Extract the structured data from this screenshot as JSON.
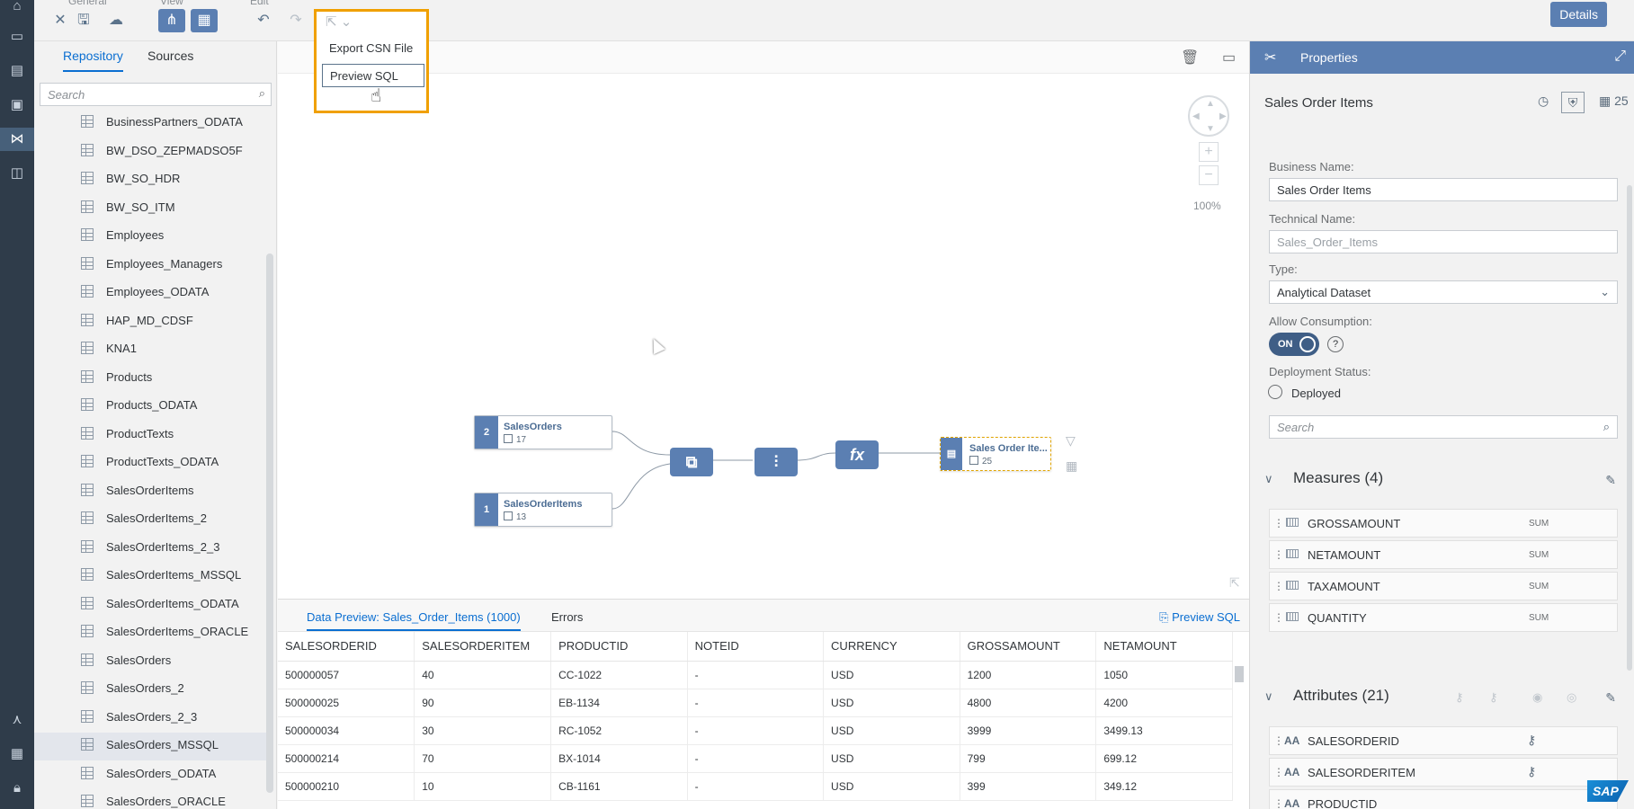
{
  "toolbar": {
    "groups": [
      "General",
      "View",
      "Edit"
    ],
    "details_label": "Details"
  },
  "export_menu": {
    "items": [
      "Export CSN File",
      "Preview SQL"
    ]
  },
  "left_panel": {
    "tabs": [
      "Repository",
      "Sources"
    ],
    "active_tab": "Repository",
    "search_placeholder": "Search",
    "items": [
      "BusinessPartners_ODATA",
      "BW_DSO_ZEPMADSO5F",
      "BW_SO_HDR",
      "BW_SO_ITM",
      "Employees",
      "Employees_Managers",
      "Employees_ODATA",
      "HAP_MD_CDSF",
      "KNA1",
      "Products",
      "Products_ODATA",
      "ProductTexts",
      "ProductTexts_ODATA",
      "SalesOrderItems",
      "SalesOrderItems_2",
      "SalesOrderItems_2_3",
      "SalesOrderItems_MSSQL",
      "SalesOrderItems_ODATA",
      "SalesOrderItems_ORACLE",
      "SalesOrders",
      "SalesOrders_2",
      "SalesOrders_2_3",
      "SalesOrders_MSSQL",
      "SalesOrders_ODATA",
      "SalesOrders_ORACLE"
    ],
    "selected_item": "SalesOrders_MSSQL"
  },
  "canvas": {
    "zoom": "100%",
    "nodes": {
      "sales_orders": {
        "badge": "2",
        "title": "SalesOrders",
        "count": "17"
      },
      "sales_order_items": {
        "badge": "1",
        "title": "SalesOrderItems",
        "count": "13"
      },
      "target": {
        "title": "Sales Order Ite...",
        "count": "25"
      }
    },
    "operators": {
      "join": "⧉",
      "projection": "⫶",
      "calculated": "fx"
    }
  },
  "preview": {
    "tabs": [
      "Data Preview: Sales_Order_Items (1000)",
      "Errors"
    ],
    "preview_sql_label": "Preview SQL",
    "columns": [
      "SALESORDERID",
      "SALESORDERITEM",
      "PRODUCTID",
      "NOTEID",
      "CURRENCY",
      "GROSSAMOUNT",
      "NETAMOUNT"
    ],
    "rows": [
      [
        "500000057",
        "40",
        "CC-1022",
        "-",
        "USD",
        "1200",
        "1050"
      ],
      [
        "500000025",
        "90",
        "EB-1134",
        "-",
        "USD",
        "4800",
        "4200"
      ],
      [
        "500000034",
        "30",
        "RC-1052",
        "-",
        "USD",
        "3999",
        "3499.13"
      ],
      [
        "500000214",
        "70",
        "BX-1014",
        "-",
        "USD",
        "799",
        "699.12"
      ],
      [
        "500000210",
        "10",
        "CB-1161",
        "-",
        "USD",
        "399",
        "349.12"
      ]
    ]
  },
  "properties": {
    "header": "Properties",
    "object_title": "Sales Order Items",
    "object_count": "25",
    "business_name_label": "Business Name:",
    "business_name": "Sales Order Items",
    "technical_name_label": "Technical Name:",
    "technical_name": "Sales_Order_Items",
    "type_label": "Type:",
    "type_value": "Analytical Dataset",
    "allow_consumption_label": "Allow Consumption:",
    "toggle_label": "ON",
    "help_glyph": "?",
    "deployment_status_label": "Deployment Status:",
    "deployment_status": "Deployed",
    "search_placeholder": "Search",
    "measures_header": "Measures (4)",
    "measures": [
      {
        "name": "GROSSAMOUNT",
        "agg": "SUM"
      },
      {
        "name": "NETAMOUNT",
        "agg": "SUM"
      },
      {
        "name": "TAXAMOUNT",
        "agg": "SUM"
      },
      {
        "name": "QUANTITY",
        "agg": "SUM"
      }
    ],
    "attributes_header": "Attributes (21)",
    "attributes": [
      "SALESORDERID",
      "SALESORDERITEM",
      "PRODUCTID"
    ],
    "logo": "SAP"
  },
  "colors": {
    "accent": "#5b7fb2",
    "rail": "#2f3c4a",
    "highlight": "#f0a000"
  }
}
